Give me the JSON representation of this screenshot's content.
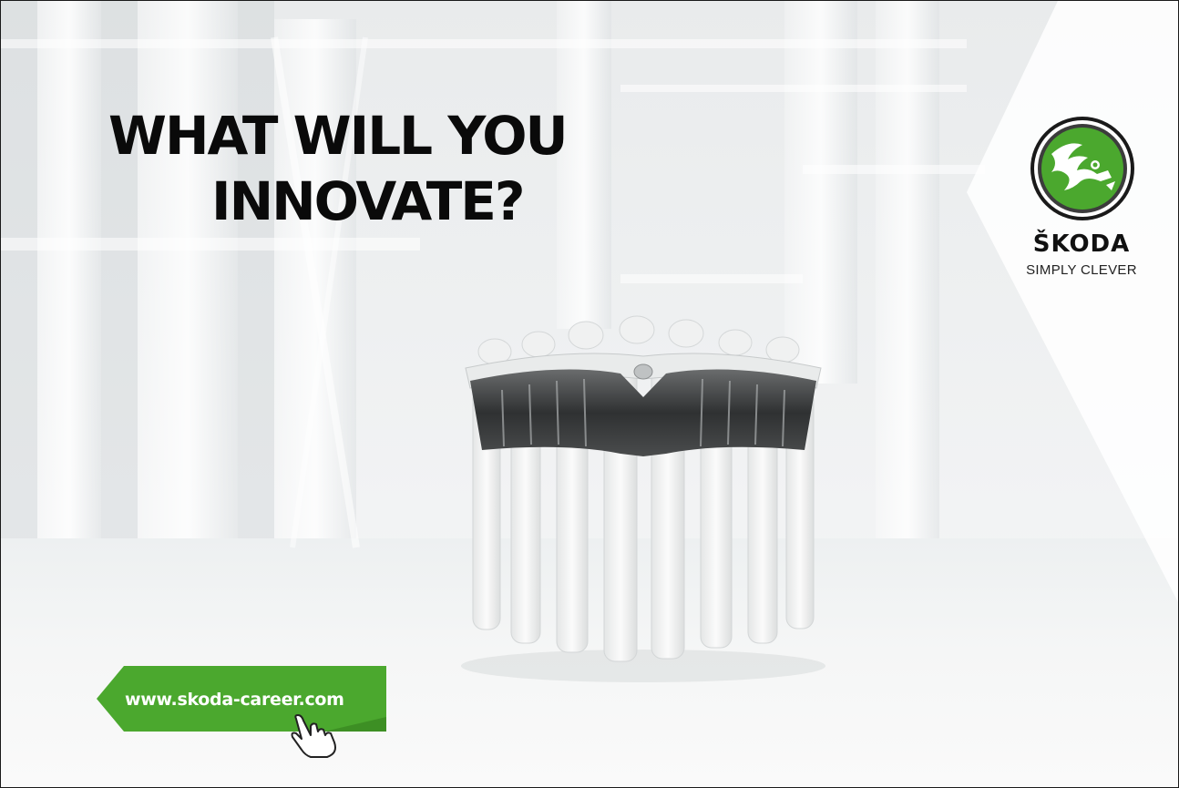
{
  "headline": {
    "line1": "WHAT WILL YOU",
    "line2": "INNOVATE?"
  },
  "brand": {
    "name": "ŠKODA",
    "tagline": "SIMPLY CLEVER",
    "logo_icon": "skoda-winged-arrow-logo",
    "accent_color": "#4ba82e"
  },
  "cta": {
    "url_label": "www.skoda-career.com",
    "pointer_icon": "hand-pointer-icon",
    "color": "#4ba82e"
  }
}
